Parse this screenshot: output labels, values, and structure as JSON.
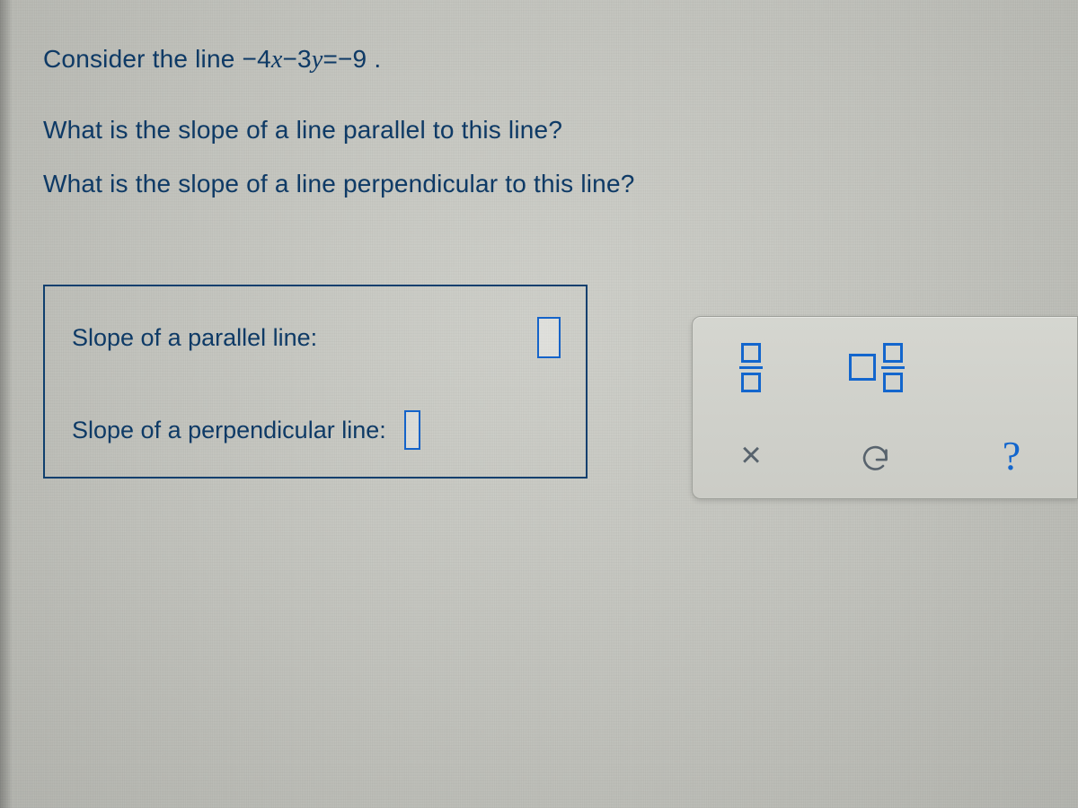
{
  "question": {
    "prefix": "Consider the line ",
    "equation_html": "−4<span class='mathital'>x</span>−3<span class='mathital'>y</span>=−9",
    "suffix": ".",
    "q1": "What is the slope of a line parallel to this line?",
    "q2": "What is the slope of a line perpendicular to this line?"
  },
  "answers": {
    "parallel_label": "Slope of a parallel line:",
    "parallel_value": "",
    "perpendicular_label": "Slope of a perpendicular line:",
    "perpendicular_value": ""
  },
  "toolbox": {
    "fraction_tool": "fraction",
    "mixed_fraction_tool": "mixed-fraction",
    "clear_tool": "×",
    "undo_tool": "undo",
    "help_tool": "?"
  },
  "colors": {
    "ink": "#0e3a66",
    "accent": "#1366cd",
    "panel": "#cfd0ca"
  }
}
